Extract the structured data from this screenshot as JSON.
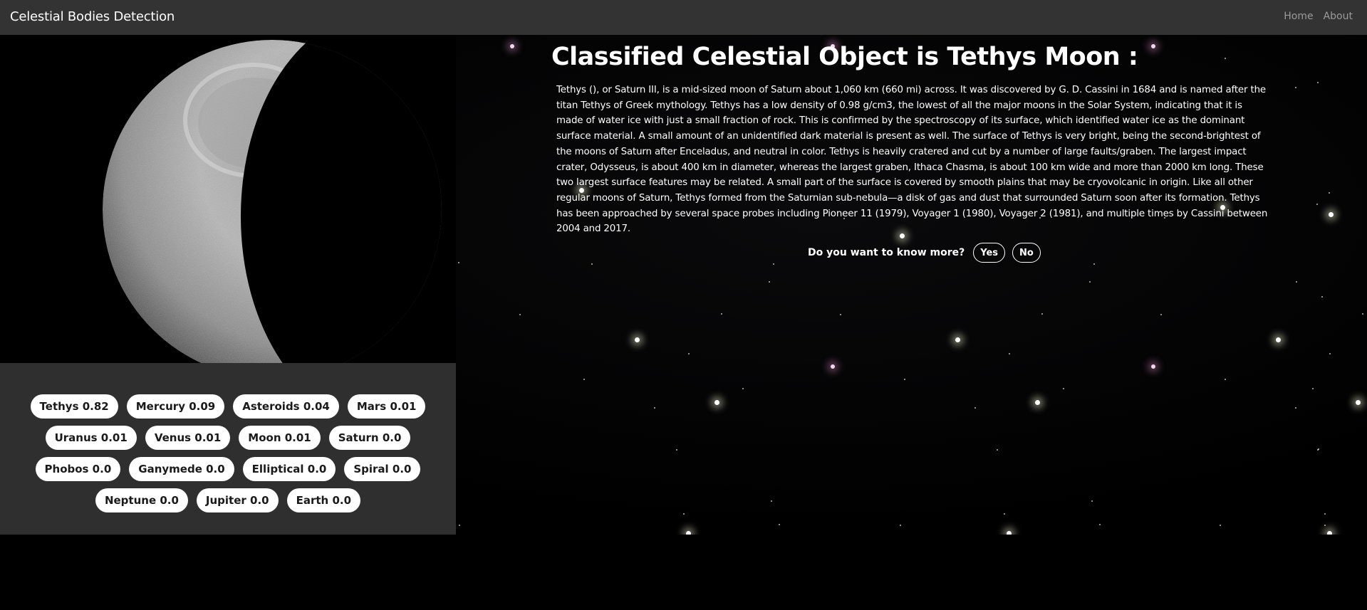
{
  "navbar": {
    "brand": "Celestial Bodies Detection",
    "links": [
      "Home",
      "About"
    ]
  },
  "image": {
    "alt": "Tethys moon photograph"
  },
  "predictions": [
    {
      "label": "Tethys 0.82"
    },
    {
      "label": "Mercury 0.09"
    },
    {
      "label": "Asteroids 0.04"
    },
    {
      "label": "Mars 0.01"
    },
    {
      "label": "Uranus 0.01"
    },
    {
      "label": "Venus 0.01"
    },
    {
      "label": "Moon 0.01"
    },
    {
      "label": "Saturn 0.0"
    },
    {
      "label": "Phobos 0.0"
    },
    {
      "label": "Ganymede 0.0"
    },
    {
      "label": "Elliptical 0.0"
    },
    {
      "label": "Spiral 0.0"
    },
    {
      "label": "Neptune 0.0"
    },
    {
      "label": "Jupiter 0.0"
    },
    {
      "label": "Earth 0.0"
    }
  ],
  "result": {
    "title": "Classified Celestial Object is Tethys Moon :",
    "description": "Tethys (), or Saturn III, is a mid-sized moon of Saturn about 1,060 km (660 mi) across. It was discovered by G. D. Cassini in 1684 and is named after the titan Tethys of Greek mythology. Tethys has a low density of 0.98 g/cm3, the lowest of all the major moons in the Solar System, indicating that it is made of water ice with just a small fraction of rock. This is confirmed by the spectroscopy of its surface, which identified water ice as the dominant surface material. A small amount of an unidentified dark material is present as well. The surface of Tethys is very bright, being the second-brightest of the moons of Saturn after Enceladus, and neutral in color. Tethys is heavily cratered and cut by a number of large faults/graben. The largest impact crater, Odysseus, is about 400 km in diameter, whereas the largest graben, Ithaca Chasma, is about 100 km wide and more than 2000 km long. These two largest surface features may be related. A small part of the surface is covered by smooth plains that may be cryovolcanic in origin. Like all other regular moons of Saturn, Tethys formed from the Saturnian sub-nebula—a disk of gas and dust that surrounded Saturn soon after its formation. Tethys has been approached by several space probes including Pioneer 11 (1979), Voyager 1 (1980), Voyager 2 (1981), and multiple times by Cassini between 2004 and 2017."
  },
  "know_more": {
    "question": "Do you want to know more?",
    "yes_label": "Yes",
    "no_label": "No"
  },
  "colors": {
    "navbar_bg": "#333333",
    "tags_panel_bg": "#2f2f2f",
    "page_bg": "#000000",
    "nav_link": "#9a9a9a"
  }
}
